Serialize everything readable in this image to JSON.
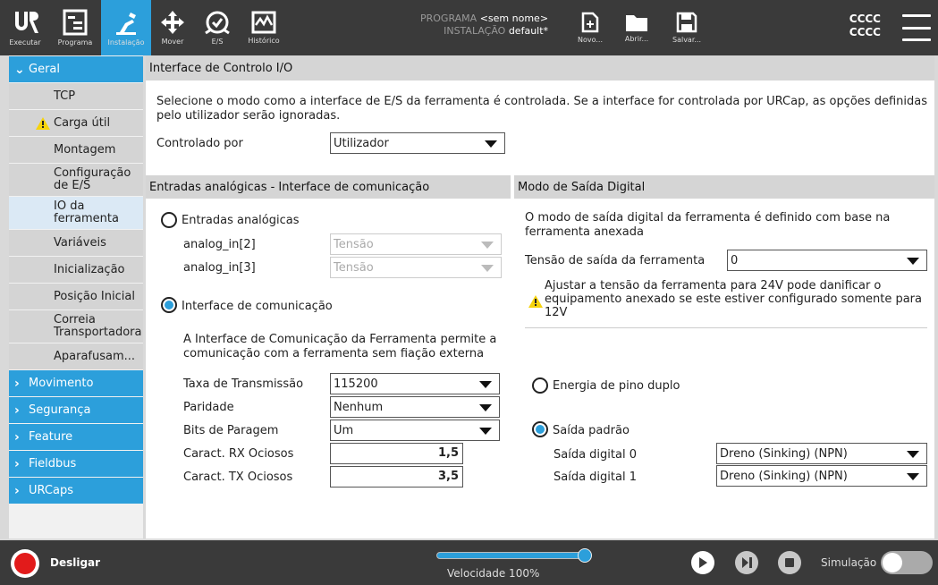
{
  "topbar": {
    "nav": [
      {
        "label": "Executar",
        "icon": "ur-logo-icon"
      },
      {
        "label": "Programa",
        "icon": "program-icon"
      },
      {
        "label": "Instalação",
        "icon": "installation-icon",
        "active": true
      },
      {
        "label": "Mover",
        "icon": "move-icon"
      },
      {
        "label": "E/S",
        "icon": "io-icon"
      },
      {
        "label": "Histórico",
        "icon": "log-icon"
      }
    ],
    "programa_label": "PROGRAMA",
    "programa_value": "<sem nome>",
    "instalacao_label": "INSTALAÇÃO",
    "instalacao_value": "default*",
    "file_buttons": [
      {
        "label": "Novo...",
        "icon": "new-file-icon"
      },
      {
        "label": "Abrir...",
        "icon": "folder-icon"
      },
      {
        "label": "Salvar...",
        "icon": "save-icon"
      }
    ],
    "user_line1": "CCCC",
    "user_line2": "CCCC"
  },
  "sidebar": {
    "geral": "Geral",
    "items": [
      "TCP",
      "Carga útil",
      "Montagem",
      "Configuração de E/S",
      "IO da ferramenta",
      "Variáveis",
      "Inicialização",
      "Posição Inicial",
      "Correia Transportadora",
      "Aparafusam..."
    ],
    "item_lines": {
      "config_l1": "Configuração",
      "config_l2": "de E/S",
      "io_l1": "IO da",
      "io_l2": "ferramenta",
      "correia_l1": "Correia",
      "correia_l2": "Transportadora"
    },
    "groups": [
      "Movimento",
      "Segurança",
      "Feature",
      "Fieldbus",
      "URCaps"
    ]
  },
  "main": {
    "header": "Interface de Controlo I/O",
    "description_l1": "Selecione o modo como a interface de E/S da ferramenta é controlada. Se a interface for controlada por URCap, as opções definidas",
    "description_l2": "pelo utilizador serão ignoradas.",
    "controlled_by_label": "Controlado por",
    "controlled_by_value": "Utilizador",
    "left": {
      "header": "Entradas analógicas - Interface de comunicação",
      "analog_radio": "Entradas analógicas",
      "analog_in2": "analog_in[2]",
      "analog_in3": "analog_in[3]",
      "tensao": "Tensão",
      "comm_radio": "Interface de comunicação",
      "comm_desc_l1": "A Interface de Comunicação da Ferramenta permite a",
      "comm_desc_l2": "comunicação com a ferramenta sem fiação externa",
      "baud_label": "Taxa de Transmissão",
      "baud_value": "115200",
      "parity_label": "Paridade",
      "parity_value": "Nenhum",
      "stop_label": "Bits de Paragem",
      "stop_value": "Um",
      "rx_label": "Caract. RX Ociosos",
      "rx_value": "1,5",
      "tx_label": "Caract. TX Ociosos",
      "tx_value": "3,5"
    },
    "right": {
      "header": "Modo de Saída Digital",
      "desc_l1": "O modo de saída digital da ferramenta é definido com base na",
      "desc_l2": "ferramenta anexada",
      "voltage_label": "Tensão de saída da ferramenta",
      "voltage_value": "0",
      "warn_l1": "Ajustar a tensão da ferramenta para 24V pode danificar o",
      "warn_l2": "equipamento anexado se este estiver configurado somente para",
      "warn_l3": "12V",
      "dual_pin": "Energia de pino duplo",
      "standard": "Saída padrão",
      "do0_label": "Saída digital 0",
      "do0_value": "Dreno (Sinking) (NPN)",
      "do1_label": "Saída digital 1",
      "do1_value": "Dreno (Sinking) (NPN)"
    }
  },
  "bottombar": {
    "power_label": "Desligar",
    "speed_label": "Velocidade 100%",
    "speed_fraction": 1.0,
    "simulation_label": "Simulação"
  }
}
